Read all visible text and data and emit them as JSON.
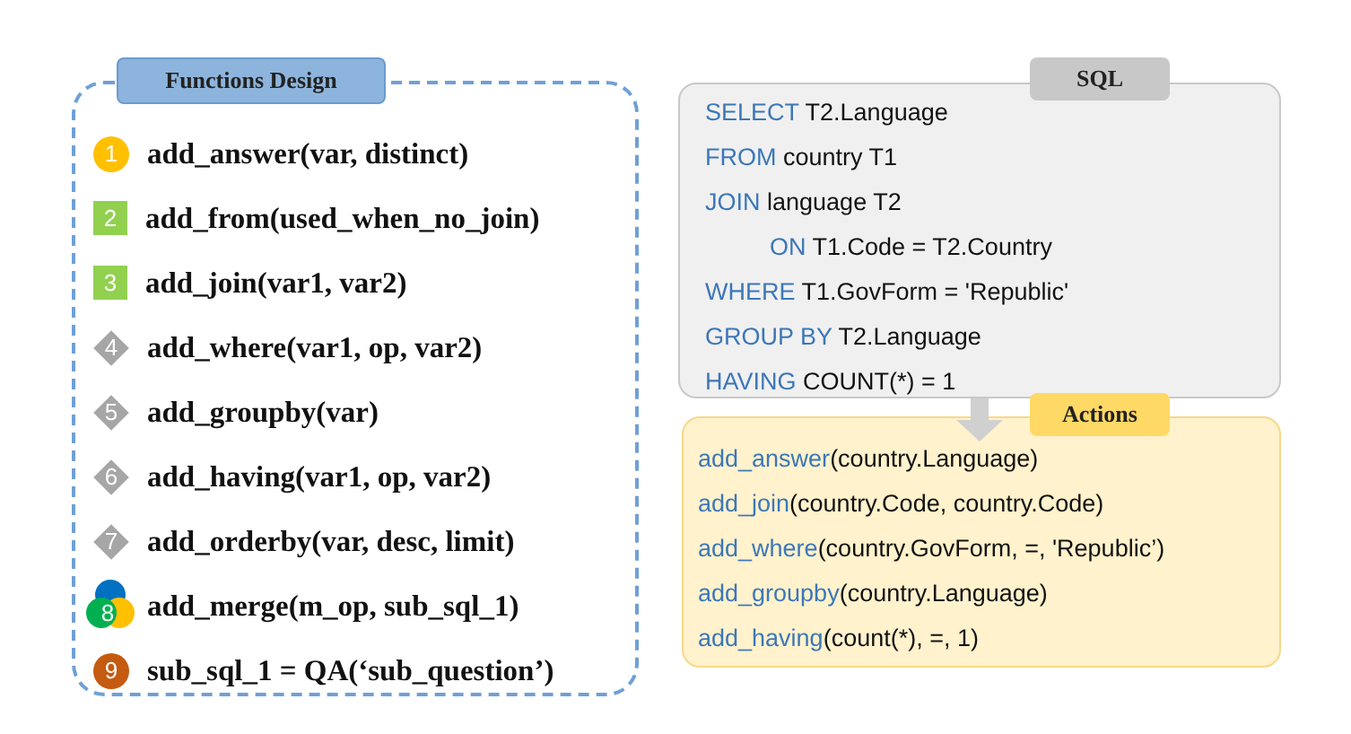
{
  "functions": {
    "title": "Functions Design",
    "items": [
      {
        "kind": "circle",
        "number": "1",
        "color": "#ffc000",
        "signature": "add_answer(var, distinct)"
      },
      {
        "kind": "square",
        "number": "2",
        "color": "#92d050",
        "signature": "add_from(used_when_no_join)"
      },
      {
        "kind": "square",
        "number": "3",
        "color": "#92d050",
        "signature": "add_join(var1, var2)"
      },
      {
        "kind": "diamond",
        "number": "4",
        "color": "#a6a6a6",
        "signature": "add_where(var1, op, var2)"
      },
      {
        "kind": "diamond",
        "number": "5",
        "color": "#a6a6a6",
        "signature": "add_groupby(var)"
      },
      {
        "kind": "diamond",
        "number": "6",
        "color": "#a6a6a6",
        "signature": "add_having(var1, op, var2)"
      },
      {
        "kind": "diamond",
        "number": "7",
        "color": "#a6a6a6",
        "signature": "add_orderby(var, desc, limit)"
      },
      {
        "kind": "merge",
        "number": "8",
        "signature": "add_merge(m_op, sub_sql_1)"
      },
      {
        "kind": "circle",
        "number": "9",
        "color": "#c55a11",
        "signature": "sub_sql_1 = QA(‘sub_question’)"
      }
    ]
  },
  "sql": {
    "title": "SQL",
    "lines": [
      {
        "keyword": "SELECT",
        "rest": "T2.Language"
      },
      {
        "keyword": "FROM",
        "rest": "country T1"
      },
      {
        "keyword": "JOIN",
        "rest": "language T2",
        "children": [
          {
            "keyword": "ON",
            "rest": "T1.Code = T2.Country"
          }
        ]
      },
      {
        "keyword": "WHERE",
        "rest": "T1.GovForm = 'Republic'"
      },
      {
        "keyword": "GROUP BY",
        "rest": "T2.Language"
      },
      {
        "keyword": "HAVING",
        "rest": "COUNT(*) = 1"
      }
    ]
  },
  "actions": {
    "title": "Actions",
    "lines": [
      {
        "function": "add_answer",
        "args": "(country.Language)"
      },
      {
        "function": "add_join",
        "args": "(country.Code, country.Code)"
      },
      {
        "function": "add_where",
        "args": "(country.GovForm, =, 'Republic’)"
      },
      {
        "function": "add_groupby",
        "args": "(country.Language)"
      },
      {
        "function": "add_having",
        "args": "(count(*), =, 1)"
      }
    ]
  }
}
